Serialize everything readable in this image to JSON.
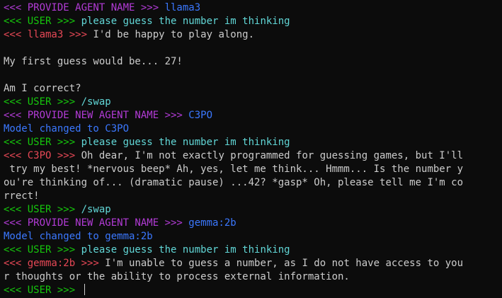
{
  "colors": {
    "background": "#0c0c0c",
    "provide": "#b23bd6",
    "user": "#16c60c",
    "agent": "#e74856",
    "cyan": "#61d6d6",
    "blue": "#3b78ff",
    "text": "#cccccc"
  },
  "terminal": {
    "lines": [
      [
        {
          "t": "<<< PROVIDE AGENT NAME >>> ",
          "c": "provide"
        },
        {
          "t": "llama3",
          "c": "blue"
        }
      ],
      [
        {
          "t": "<<< USER >>> ",
          "c": "user"
        },
        {
          "t": "please guess the number im thinking",
          "c": "cyan"
        }
      ],
      [
        {
          "t": "<<< llama3 >>> ",
          "c": "agent"
        },
        {
          "t": "I'd be happy to play along.",
          "c": "text"
        }
      ],
      [],
      [
        {
          "t": "My first guess would be... 27!",
          "c": "text"
        }
      ],
      [],
      [
        {
          "t": "Am I correct?",
          "c": "text"
        }
      ],
      [
        {
          "t": "<<< USER >>> ",
          "c": "user"
        },
        {
          "t": "/swap",
          "c": "cyan"
        }
      ],
      [
        {
          "t": "<<< PROVIDE NEW AGENT NAME >>> ",
          "c": "provide"
        },
        {
          "t": "C3PO",
          "c": "blue"
        }
      ],
      [
        {
          "t": "Model changed to C3PO",
          "c": "blue"
        }
      ],
      [
        {
          "t": "<<< USER >>> ",
          "c": "user"
        },
        {
          "t": "please guess the number im thinking",
          "c": "cyan"
        }
      ],
      [
        {
          "t": "<<< C3PO >>> ",
          "c": "agent"
        },
        {
          "t": "Oh dear, I'm not exactly programmed for guessing games, but I'll",
          "c": "text"
        }
      ],
      [
        {
          "t": " try my best! *nervous beep* Ah, yes, let me think... Hmmm... Is the number y",
          "c": "text"
        }
      ],
      [
        {
          "t": "ou're thinking of... (dramatic pause) ...42? *gasp* Oh, please tell me I'm co",
          "c": "text"
        }
      ],
      [
        {
          "t": "rrect!",
          "c": "text"
        }
      ],
      [
        {
          "t": "<<< USER >>> ",
          "c": "user"
        },
        {
          "t": "/swap",
          "c": "cyan"
        }
      ],
      [
        {
          "t": "<<< PROVIDE NEW AGENT NAME >>> ",
          "c": "provide"
        },
        {
          "t": "gemma:2b",
          "c": "blue"
        }
      ],
      [
        {
          "t": "Model changed to gemma:2b",
          "c": "blue"
        }
      ],
      [
        {
          "t": "<<< USER >>> ",
          "c": "user"
        },
        {
          "t": "please guess the number im thinking",
          "c": "cyan"
        }
      ],
      [
        {
          "t": "<<< gemma:2b >>> ",
          "c": "agent"
        },
        {
          "t": "I'm unable to guess a number, as I do not have access to you",
          "c": "text"
        }
      ],
      [
        {
          "t": "r thoughts or the ability to process external information.",
          "c": "text"
        }
      ],
      [
        {
          "t": "<<< USER >>> ",
          "c": "user"
        }
      ]
    ]
  }
}
